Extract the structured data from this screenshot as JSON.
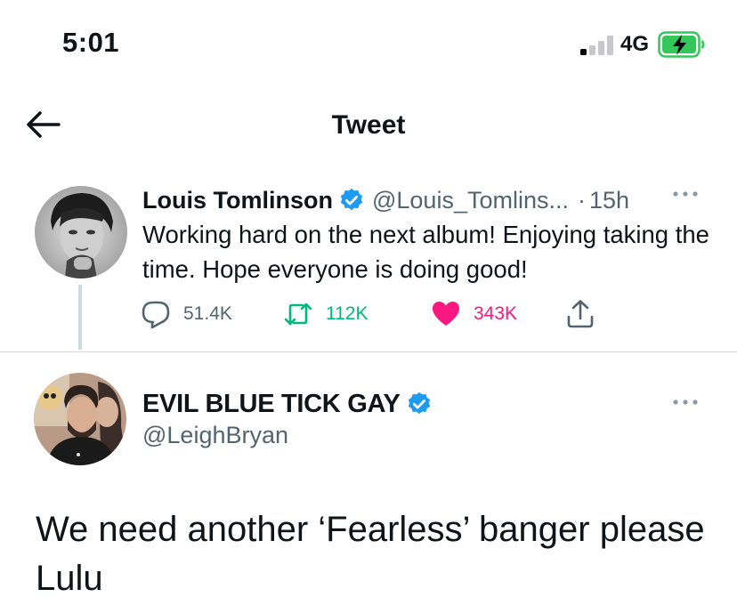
{
  "status_bar": {
    "time": "5:01",
    "network": "4G"
  },
  "header": {
    "title": "Tweet"
  },
  "tweets": [
    {
      "name": "Louis Tomlinson",
      "verified": true,
      "handle": "@Louis_Tomlins...",
      "separator": "·",
      "time": "15h",
      "text": "Working hard on the next album! Enjoying taking the time. Hope everyone is doing good!",
      "stats": {
        "replies": "51.4K",
        "retweets": "112K",
        "likes": "343K"
      },
      "liked": true
    },
    {
      "name": "EVIL BLUE TICK GAY",
      "verified": true,
      "handle": "@LeighBryan",
      "text": "We need another ‘Fearless’ banger please Lulu"
    }
  ],
  "icons": {
    "back": "arrow-left-icon",
    "more": "more-dots-icon",
    "reply": "reply-bubble-icon",
    "retweet": "retweet-icon",
    "like": "heart-icon",
    "share": "share-icon",
    "verified": "verified-badge-icon"
  },
  "colors": {
    "verified": "#1d9bf0",
    "retweet": "#00ba7c",
    "like": "#f91880",
    "muted": "#536471",
    "battery_charging": "#34c759"
  }
}
